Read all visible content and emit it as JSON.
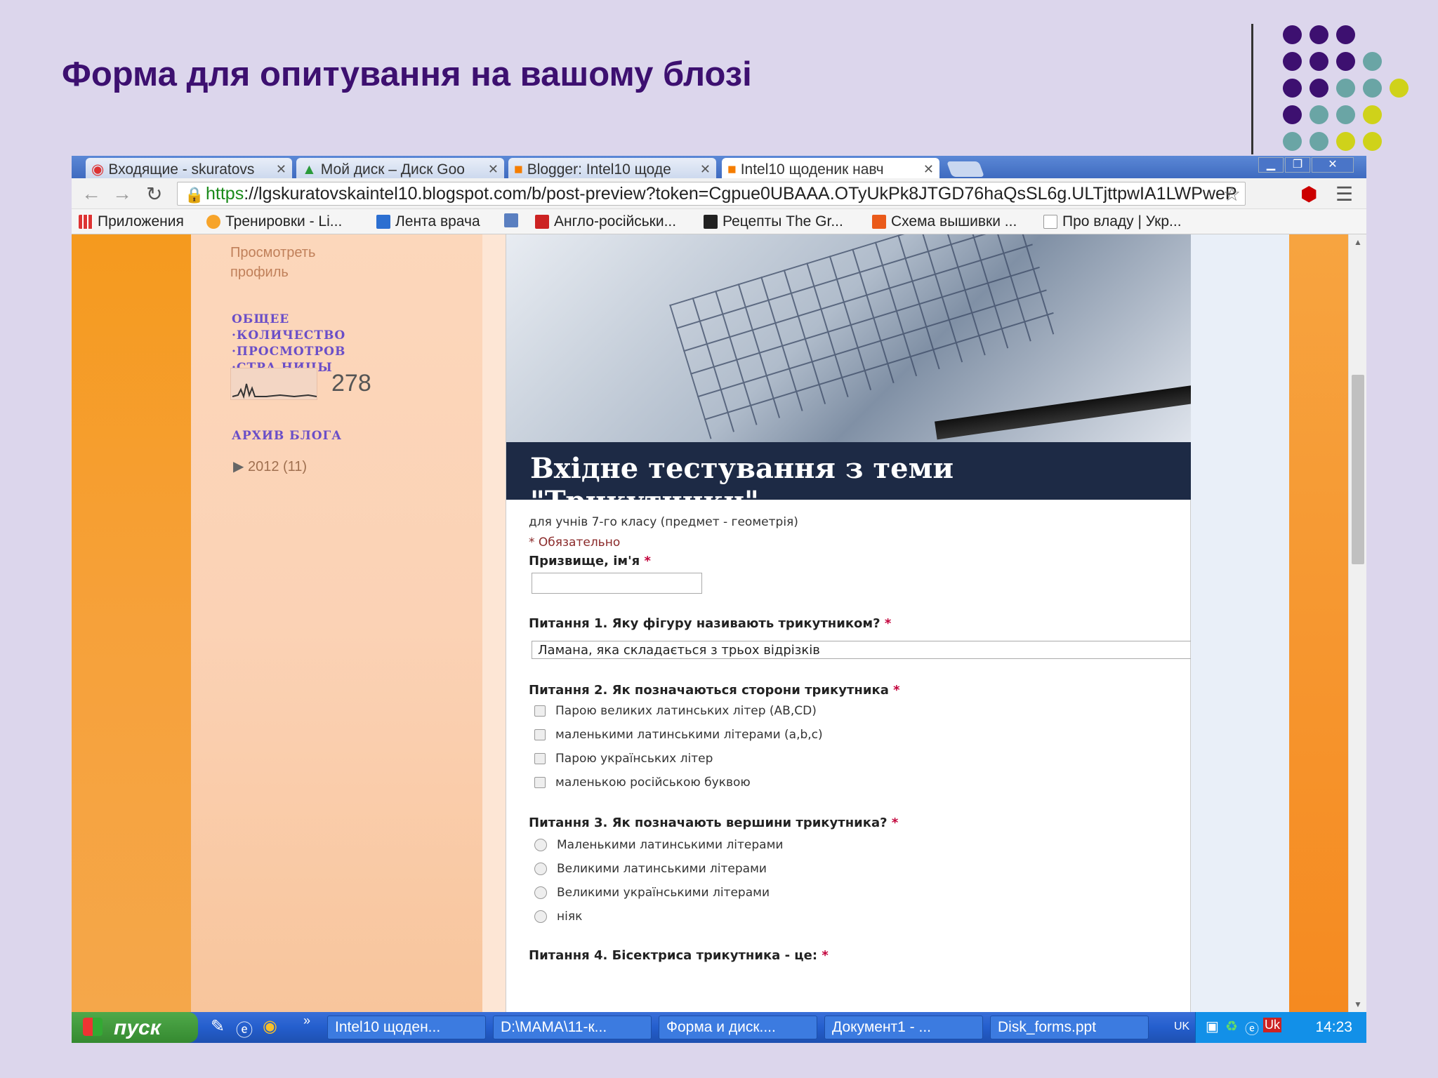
{
  "slide": {
    "title": "Форма для опитування на вашому блозі"
  },
  "colors": {
    "title": "#3d1070",
    "dot_purple": "#3d1070",
    "dot_teal": "#6aa5a5",
    "dot_yellow": "#cfd21a"
  },
  "browser": {
    "tabs": [
      {
        "label": "Входящие - skuratovs",
        "icon": "gmail-icon"
      },
      {
        "label": "Мой диск – Диск Goo",
        "icon": "drive-icon"
      },
      {
        "label": "Blogger: Intel10 щоде",
        "icon": "blogger-icon"
      },
      {
        "label": "Intel10 щоденик навч",
        "icon": "blogger-icon"
      }
    ],
    "url_scheme": "https",
    "url_rest": "://lgskuratovskaintel10.blogspot.com/b/post-preview?token=Cgpue0UBAAA.OTyUkPk8JTGD76haQsSL6g.ULTjttpwIA1LWPweP",
    "bookmarks": [
      "Приложения",
      "Тренировки - Li...",
      "Лента врача",
      "Англо-російськи...",
      "Рецепты The Gr...",
      "Схема вышивки ...",
      "Про владу | Укр..."
    ]
  },
  "sidebar": {
    "profile_link": "Просмотреть профиль",
    "views_heading": "ОБЩЕЕ ·КОЛИЧЕСТВО ·ПРОСМОТРОВ ·СТРА НИЦЫ",
    "views_count": "278",
    "archive_heading": "АРХИВ БЛОГА",
    "archive_item": "2012 (11)"
  },
  "post": {
    "banner_title": "Вхідне тестування з теми \"Трикутники\"",
    "description": "для учнів 7-го класу (предмет - геометрія)",
    "required_note": "* Обязательно",
    "q_name": "Призвище, ім'я",
    "q1": "Питання 1. Яку фігуру називають трикутником?",
    "q1_selected": "Ламана, яка складається з трьох відрізків",
    "q2": "Питання 2. Як позначаються сторони трикутника",
    "q2_options": [
      "Парою великих латинських літер (AB,CD)",
      "маленькими латинськими літерами (a,b,c)",
      "Парою українських літер",
      "маленькою російською буквою"
    ],
    "q3": "Питання 3. Як позначають вершини трикутника?",
    "q3_options": [
      "Маленькими латинськими літерами",
      "Великими латинськими літерами",
      "Великими українськими літерами",
      "ніяк"
    ],
    "q4": "Питання 4. Бісектриса трикутника - це:",
    "star": "*"
  },
  "taskbar": {
    "start": "пуск",
    "items": [
      "Intel10 щоден...",
      "D:\\МАМА\\11-к...",
      "Форма и диск....",
      "Документ1 - ...",
      "Disk_forms.ppt"
    ],
    "lang": "UK",
    "clock": "14:23"
  }
}
